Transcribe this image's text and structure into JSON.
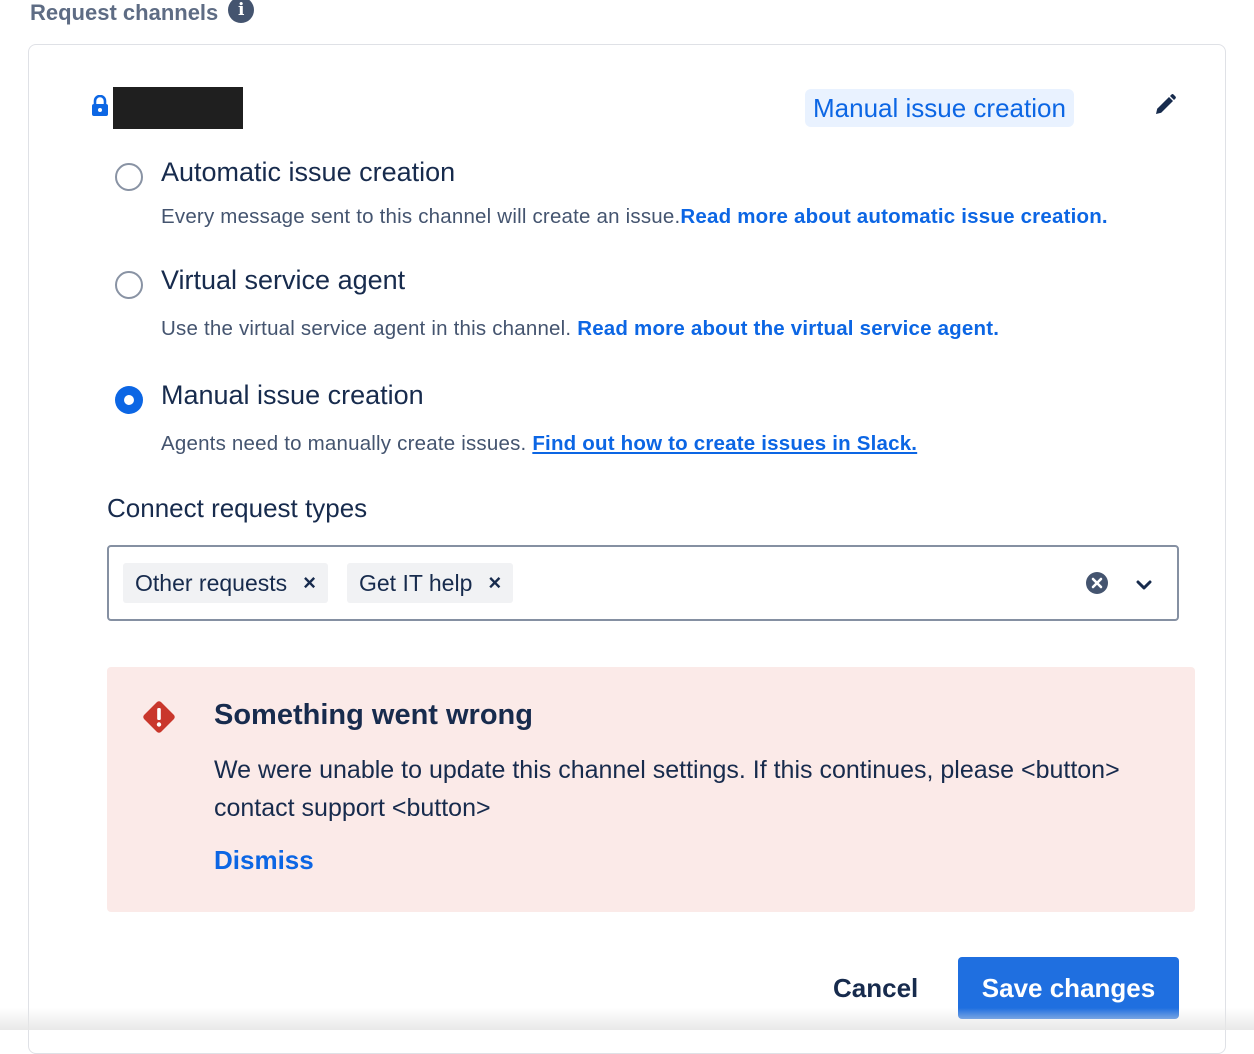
{
  "section": {
    "title": "Request channels",
    "info_icon": "info-icon"
  },
  "channel": {
    "lock_icon": "lock-icon",
    "mode_lozenge": "Manual issue creation",
    "edit_icon": "pencil-icon"
  },
  "options": [
    {
      "label": "Automatic issue creation",
      "description": "Every message sent to this channel will create an issue.",
      "link": "Read more about automatic issue creation.",
      "checked": false
    },
    {
      "label": "Virtual service agent",
      "description": "Use the virtual service agent in this channel. ",
      "link": "Read more about the virtual service agent.",
      "checked": false
    },
    {
      "label": "Manual issue creation",
      "description": "Agents need to manually create issues. ",
      "link": "Find out how to create issues in Slack.",
      "checked": true
    }
  ],
  "request_types": {
    "label": "Connect request types",
    "tags": [
      "Other requests",
      "Get IT help"
    ],
    "remove_glyph": "×"
  },
  "error": {
    "title": "Something went wrong",
    "body": "We were unable to update this channel settings. If this continues, please <button> contact support <button>",
    "dismiss": "Dismiss",
    "color": "#c9372c"
  },
  "actions": {
    "cancel": "Cancel",
    "save": "Save changes"
  },
  "colors": {
    "accent": "#0c66e4",
    "error_bg": "#fbeae8"
  }
}
